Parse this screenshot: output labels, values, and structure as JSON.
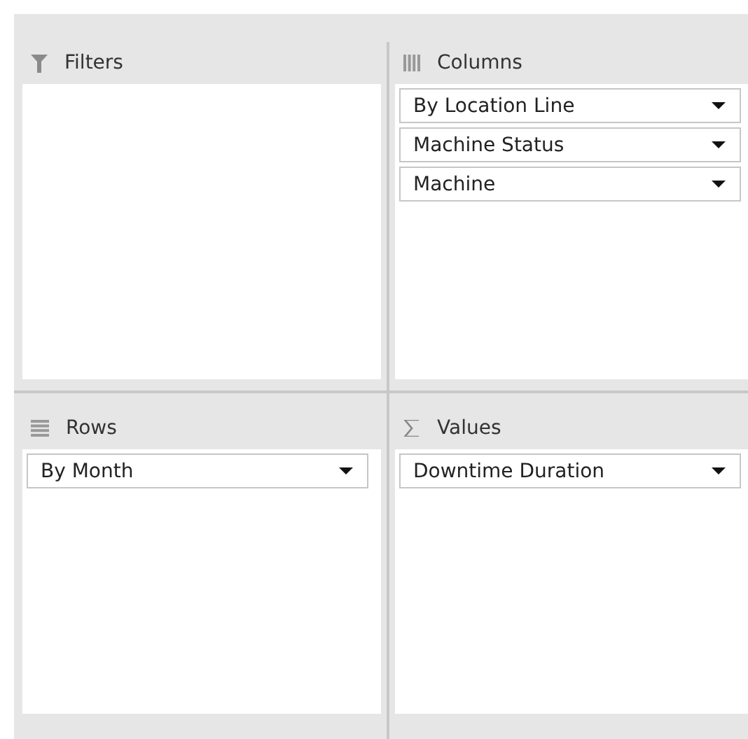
{
  "areas": [
    {
      "kind": "filters",
      "title": "Filters"
    },
    {
      "kind": "columns",
      "title": "Columns",
      "fields": [
        "By Location Line",
        "Machine Status",
        "Machine"
      ]
    },
    {
      "kind": "rows",
      "title": "Rows",
      "fields": [
        "By Month"
      ]
    },
    {
      "kind": "values",
      "title": "Values",
      "fields": [
        "Downtime Duration"
      ]
    }
  ]
}
